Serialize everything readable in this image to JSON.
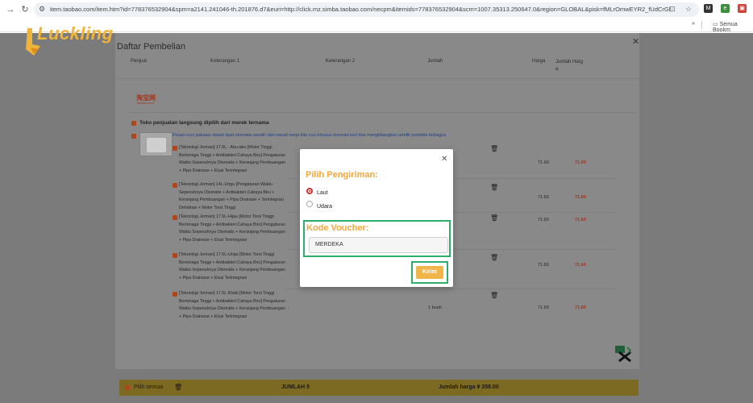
{
  "browser": {
    "url": "item.taobao.com/item.htm?id=778376532904&spm=a2141.241046-th.201876.d7&euri=http://click.mz.simba.taobao.com/necpm&itemids=778376532904&scm=1007.35313.250647.0&region=GLOBAL&pisk=fMLrOmwEYR2_fUdCrGhFAC5u1W...",
    "bookmarks_label": "Semua Bookm"
  },
  "logo": {
    "text": "Luckling"
  },
  "panel": {
    "title": "Daftar Pembelian",
    "columns": [
      "Penjual",
      "Keterangan 1",
      "Keterangan 2",
      "Jumlah",
      "Harga",
      "Jumlah Harg\na"
    ],
    "store_logo": "淘宝网",
    "store_logo_sub": "Taobao.com",
    "seller_label": "Toko penjualan langsung dipilih dari merek ternama",
    "notice": "Pesan-cuci pakaian dalam lipat otomatis sendiri dan nanah kerja kita cuci khusus mencari kerl dan menghilangkan artefik portable terbagus",
    "items": [
      {
        "desc": "[Teknologi Jerman] 17.5L - Abu-abu [Motor Tinggi Bertenaga Tinggi + Antibakteri Cahaya Biru] Pengaturan Waktu Sepenuhnya Otomatis + Keranjang Pembuangan + Pipa Drainase + Elusi Terintegrasi",
        "price": "71.60",
        "total": "71.60"
      },
      {
        "desc": "[Teknologi Jerman] 14L-Ungu [Pengaturan Waktu Sepenuhnya Otomatis + Antibakteri Cahaya Biru + Keranjang Pembuangan + Pipa Drainase + Terintegrasi Dehidrasi + Motor Torsi Tinggi",
        "price": "71.60",
        "total": "71.60"
      },
      {
        "desc": "[Teknologi Jerman] 17.5L-Hijau [Motor Torsi Tinggi Bertenaga Tinggi + Antibakteri Cahaya Biru] Pengaturan Waktu Sepenuhnya Otomatis + Keranjang Pembuangan + Pipa Drainase + Elusi Terintegrasi",
        "price": "71.60",
        "total": "71.60"
      },
      {
        "desc": "[Teknologi Jerman] 17.5L-Ungu [Motor Torsi Tinggi Bertenaga Tinggi + Antibakteri Cahaya Biru] Pengaturan Waktu Sepenuhnya Otomatis + Keranjang Pembuangan + Pipa Drainase + Elusi Terintegrasi",
        "price": "71.60",
        "total": "71.60"
      },
      {
        "desc": "[Teknologi Jerman] 17.5L Khaki [Motor Torsi Tinggi Bertenaga Tinggi + Antibakteri Cahaya Biru] Pengaturan Waktu Sepenuhnya Otomatis + Keranjang Pembuangan + Pipa Drainase + Elusi Terintegrasi",
        "price": "71.60",
        "total": "71.60",
        "qty": "1 buah"
      }
    ]
  },
  "bottom_bar": {
    "select_all": "Pilih semua",
    "total_count": "JUMLAH 5",
    "total_price": "Jumlah harga ¥ 358.00"
  },
  "modal": {
    "shipping_heading": "Pilih Pengiriman:",
    "options": [
      {
        "label": "Laut",
        "selected": true
      },
      {
        "label": "Udara",
        "selected": false
      }
    ],
    "voucher_heading": "Kode Voucher:",
    "voucher_value": "MERDEKA",
    "submit_label": "Kirim"
  },
  "colors": {
    "accent_orange": "#f2a93b",
    "highlight_green": "#2fae6b",
    "price_red": "#a3341d"
  }
}
